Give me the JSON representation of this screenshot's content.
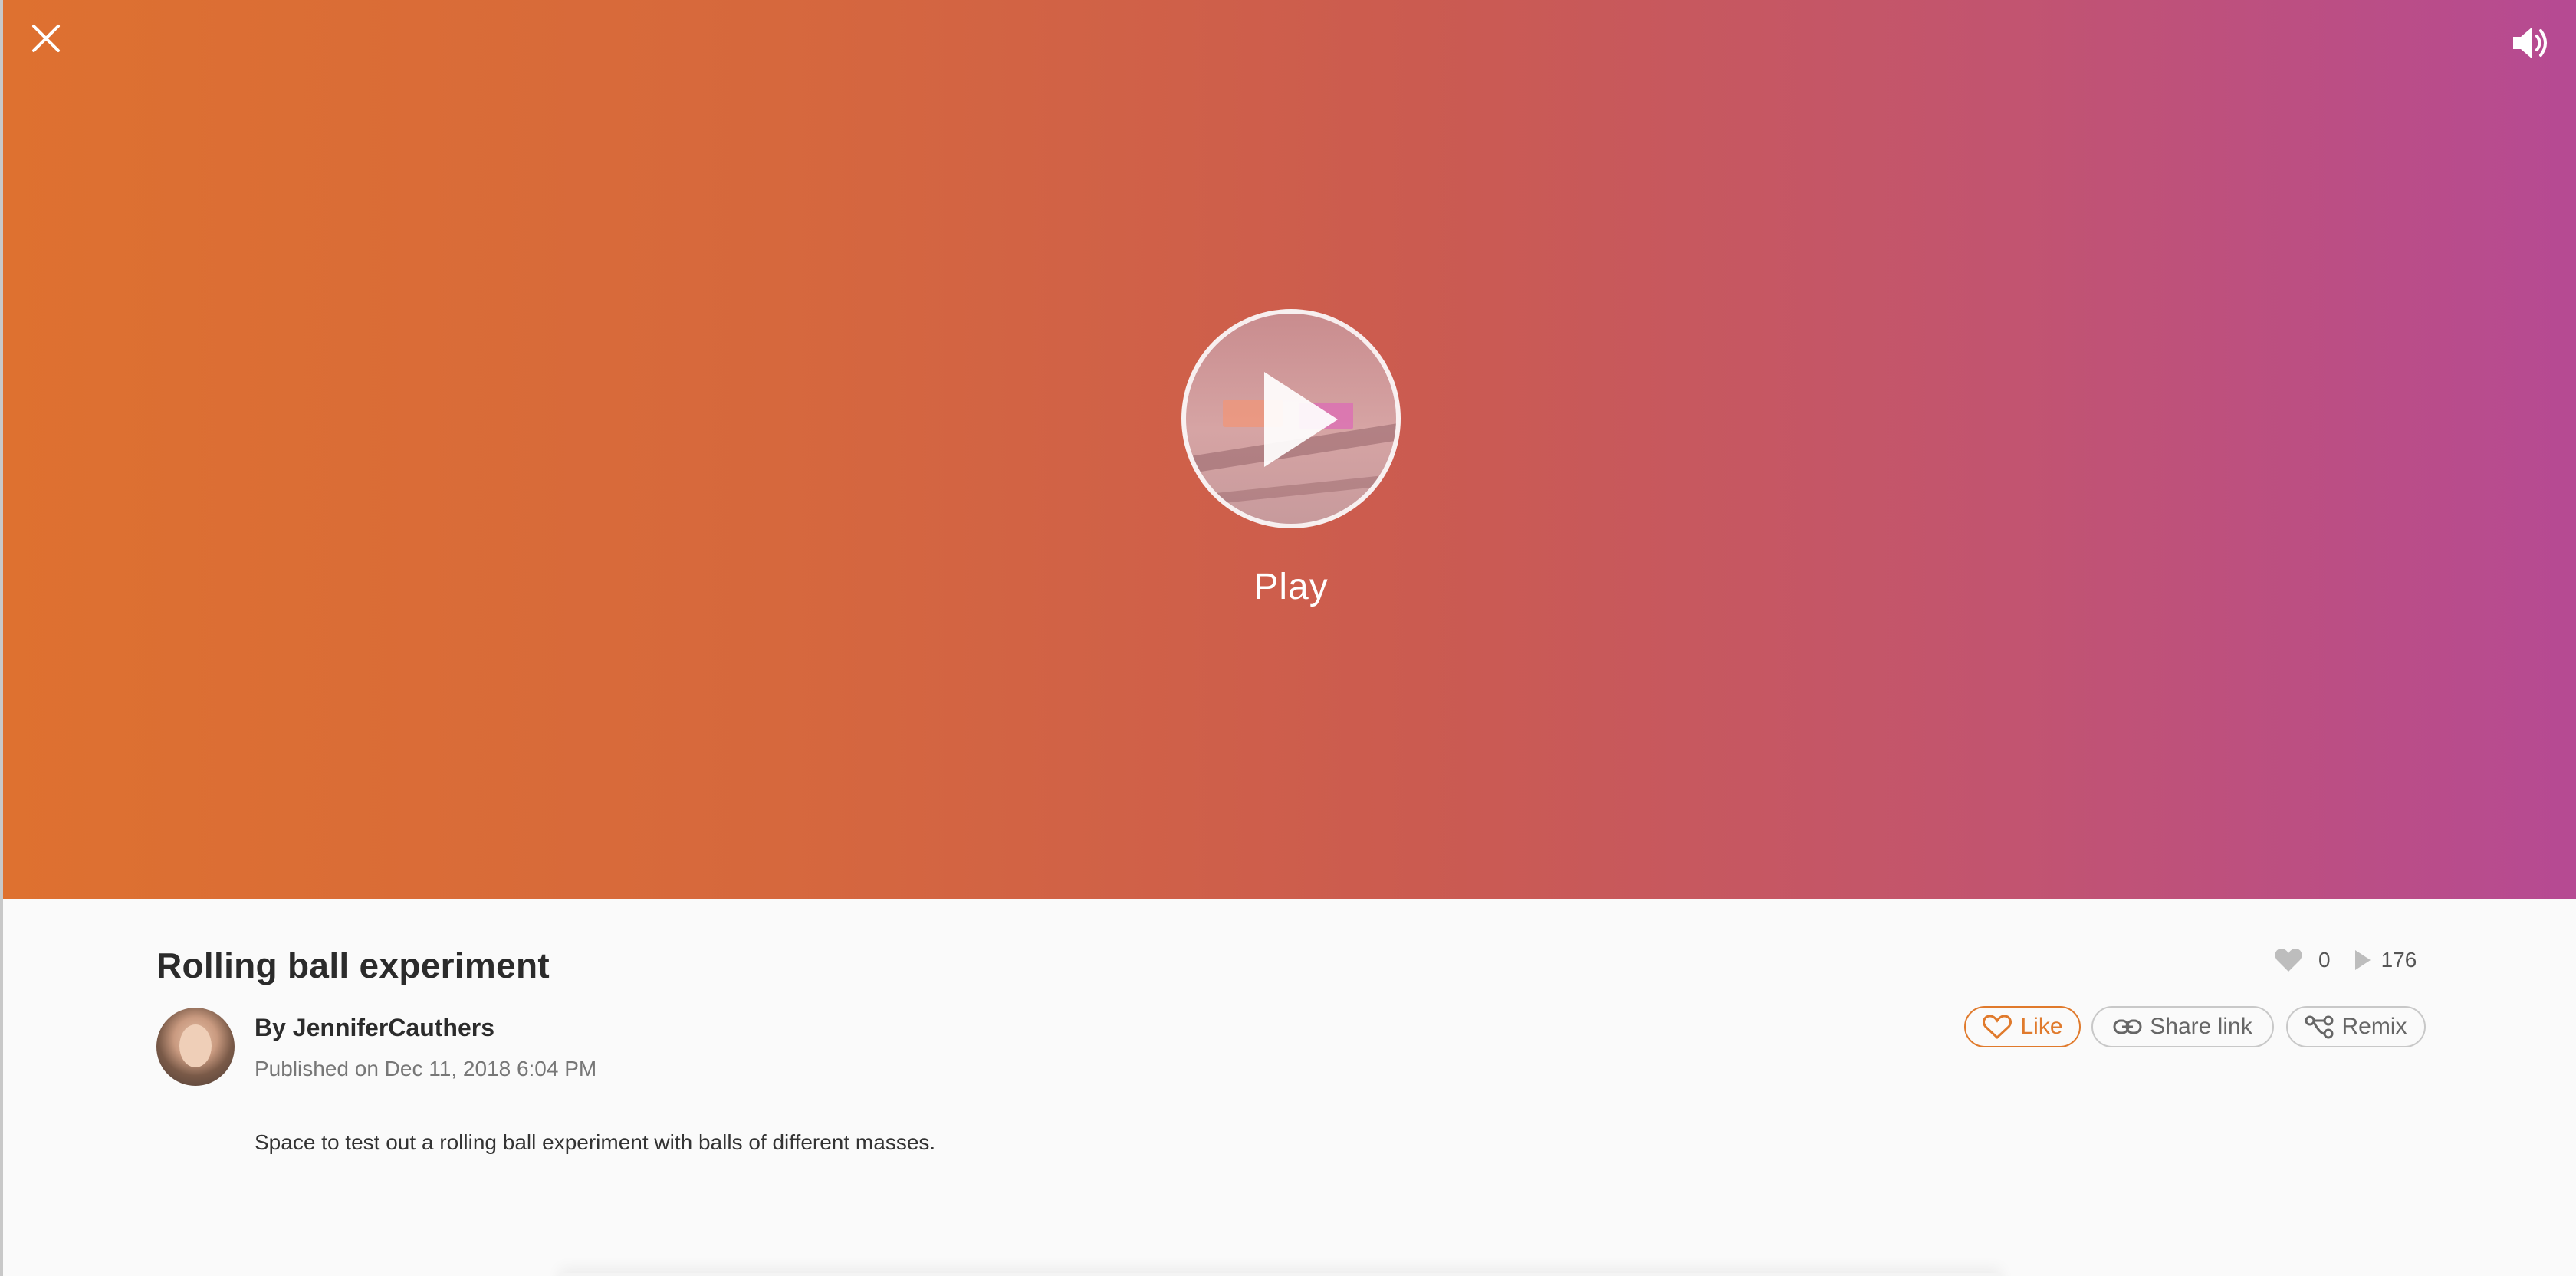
{
  "hero": {
    "gradient_start": "#de7130",
    "gradient_end": "#b64a93",
    "close_icon": "close-icon",
    "sound_icon": "volume-icon",
    "play_label": "Play"
  },
  "project": {
    "title": "Rolling ball experiment",
    "author": "By JenniferCauthers",
    "published": "Published on Dec 11, 2018 6:04 PM",
    "description": "Space to test out a rolling ball experiment with balls of different masses."
  },
  "stats": {
    "likes": "0",
    "views": "176"
  },
  "actions": {
    "like_label": "Like",
    "share_label": "Share link",
    "remix_label": "Remix",
    "accent_color": "#e07a2c"
  }
}
